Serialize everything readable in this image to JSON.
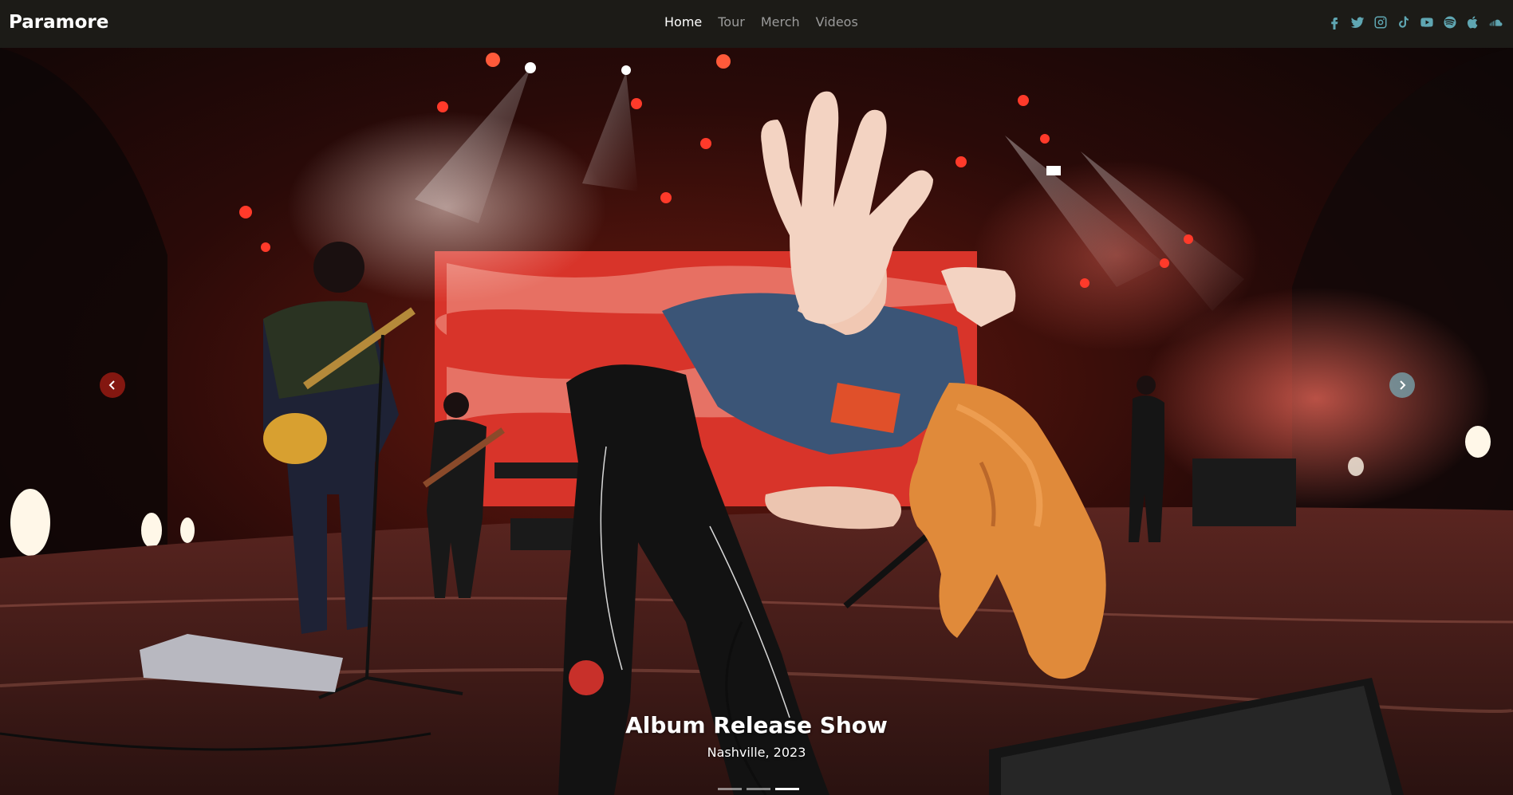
{
  "brand": "Paramore",
  "nav": {
    "items": [
      {
        "label": "Home",
        "active": true
      },
      {
        "label": "Tour",
        "active": false
      },
      {
        "label": "Merch",
        "active": false
      },
      {
        "label": "Videos",
        "active": false
      }
    ]
  },
  "social": {
    "color": "#5fa6b2",
    "icons": [
      "facebook-icon",
      "twitter-icon",
      "instagram-icon",
      "tiktok-icon",
      "youtube-icon",
      "spotify-icon",
      "apple-icon",
      "soundcloud-icon"
    ]
  },
  "carousel": {
    "slide_title": "Album Release Show",
    "slide_subtitle": "Nashville, 2023",
    "slide_count": 3,
    "active_index": 2
  },
  "colors": {
    "navbar_bg": "#1c1b17",
    "accent": "#5fa6b2"
  }
}
